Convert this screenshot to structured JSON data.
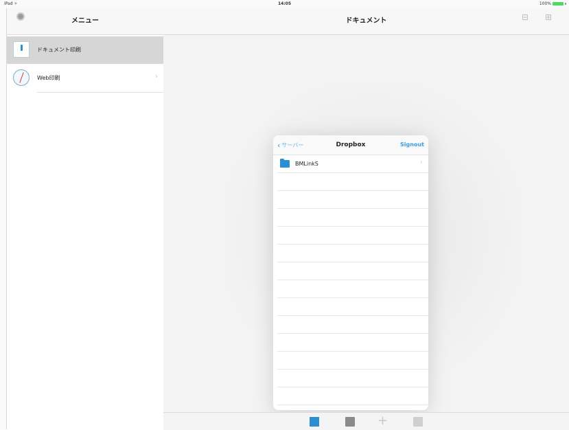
{
  "status_bar": {
    "carrier": "iPad ✧",
    "time": "14:05",
    "battery": "100%"
  },
  "left_panel": {
    "title": "メニュー",
    "items": [
      {
        "label": "ドキュメント印刷",
        "icon": "document-print-icon",
        "selected": true
      },
      {
        "label": "Web印刷",
        "icon": "compass-icon",
        "selected": false
      }
    ]
  },
  "main": {
    "title": "ドキュメント"
  },
  "popup": {
    "back_label": "サーバー",
    "title": "Dropbox",
    "signout_label": "Signout",
    "rows": [
      {
        "label": "BMLinkS",
        "icon": "folder-icon"
      }
    ]
  },
  "colors": {
    "accent": "#2b8fd1",
    "selected_row": "#d6d6d6",
    "battery": "#4cd964"
  }
}
